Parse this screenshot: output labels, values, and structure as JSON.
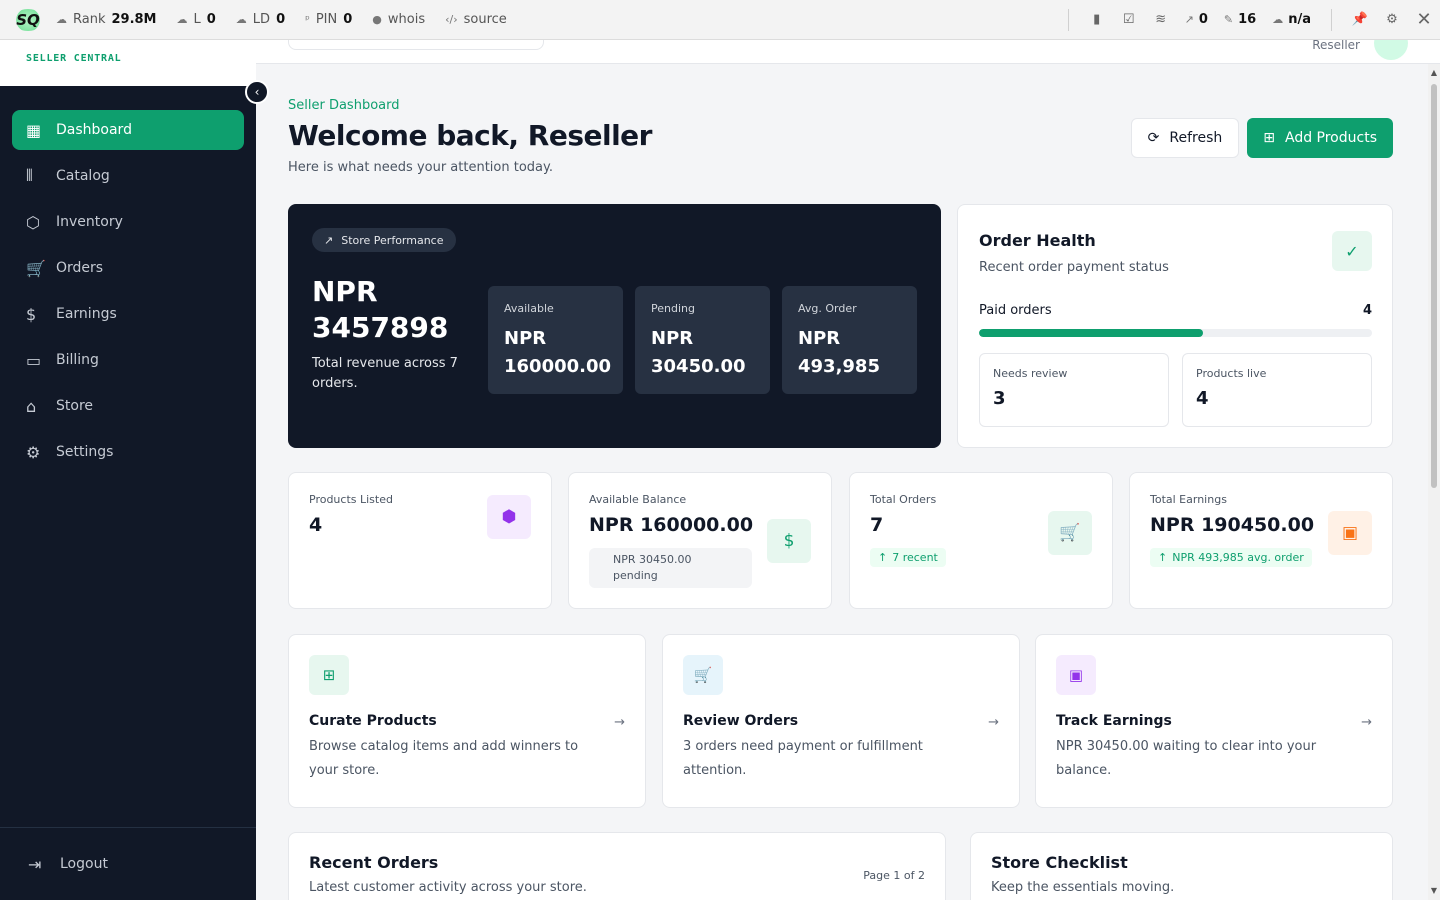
{
  "seobar": {
    "logo": "SQ",
    "metrics": [
      {
        "label": "Rank",
        "value": "29.8M"
      },
      {
        "label": "L",
        "value": "0"
      },
      {
        "label": "LD",
        "value": "0"
      },
      {
        "label": "PIN",
        "value": "0"
      },
      {
        "label": "whois",
        "value": ""
      },
      {
        "label": "source",
        "value": ""
      }
    ],
    "right_metrics": [
      {
        "value": "0"
      },
      {
        "value": "16"
      },
      {
        "value": "n/a"
      }
    ]
  },
  "sidebar": {
    "tagline": "SELLER CENTRAL",
    "items": [
      {
        "label": "Dashboard",
        "icon": "dashboard-icon",
        "active": true
      },
      {
        "label": "Catalog",
        "icon": "library-icon"
      },
      {
        "label": "Inventory",
        "icon": "box-icon"
      },
      {
        "label": "Orders",
        "icon": "cart-icon"
      },
      {
        "label": "Earnings",
        "icon": "dollar-icon"
      },
      {
        "label": "Billing",
        "icon": "card-icon"
      },
      {
        "label": "Store",
        "icon": "store-icon"
      },
      {
        "label": "Settings",
        "icon": "gear-icon"
      }
    ],
    "logout": "Logout"
  },
  "header": {
    "role": "Reseller"
  },
  "page": {
    "breadcrumb": "Seller Dashboard",
    "title": "Welcome back, Reseller",
    "subtitle": "Here is what needs your attention today.",
    "refresh_label": "Refresh",
    "add_label": "Add Products"
  },
  "performance": {
    "pill": "Store Performance",
    "total": "NPR 3457898",
    "description": "Total revenue across 7 orders.",
    "stats": [
      {
        "label": "Available",
        "value": "NPR 160000.00"
      },
      {
        "label": "Pending",
        "value": "NPR 30450.00"
      },
      {
        "label": "Avg. Order",
        "value": "NPR 493,985"
      }
    ]
  },
  "order_health": {
    "title": "Order Health",
    "subtitle": "Recent order payment status",
    "paid_label": "Paid orders",
    "paid_value": "4",
    "paid_fraction": 0.57,
    "needs_review_label": "Needs review",
    "needs_review_value": "3",
    "products_live_label": "Products live",
    "products_live_value": "4"
  },
  "kpis": {
    "products": {
      "label": "Products Listed",
      "value": "4"
    },
    "balance": {
      "label": "Available Balance",
      "value": "NPR 160000.00",
      "chip": "NPR 30450.00 pending"
    },
    "orders": {
      "label": "Total Orders",
      "value": "7",
      "chip": "7 recent"
    },
    "earnings": {
      "label": "Total Earnings",
      "value": "NPR 190450.00",
      "chip": "NPR 493,985 avg. order"
    }
  },
  "quick": [
    {
      "title": "Curate Products",
      "desc": "Browse catalog items and add winners to your store."
    },
    {
      "title": "Review Orders",
      "desc": "3 orders need payment or fulfillment attention."
    },
    {
      "title": "Track Earnings",
      "desc": "NPR 30450.00 waiting to clear into your balance."
    }
  ],
  "recent_orders": {
    "title": "Recent Orders",
    "subtitle": "Latest customer activity across your store.",
    "page": "Page 1 of 2"
  },
  "checklist": {
    "title": "Store Checklist",
    "subtitle": "Keep the essentials moving."
  },
  "colors": {
    "accent": "#0e9f6e",
    "sidebar": "#111827",
    "purple": "#9333ea",
    "orange": "#f97316",
    "blue": "#0284c7"
  }
}
